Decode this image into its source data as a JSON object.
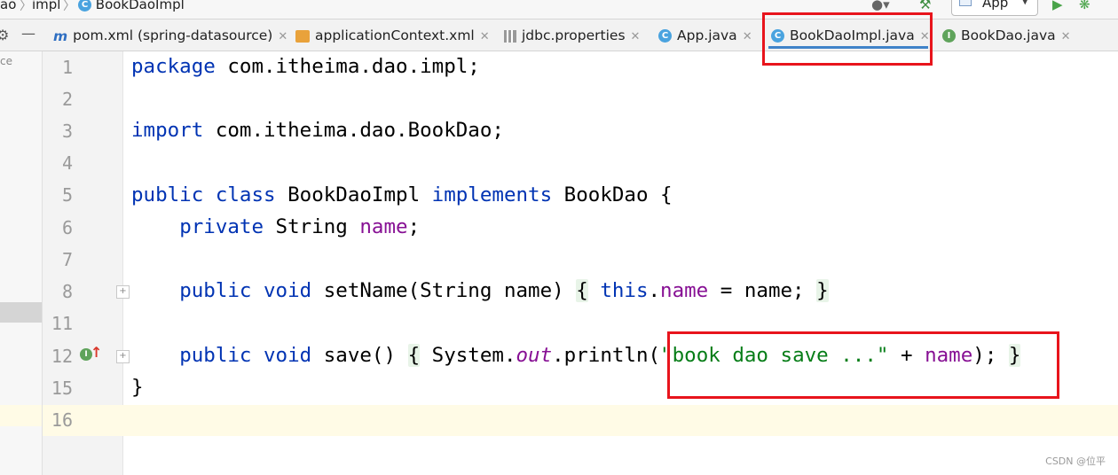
{
  "breadcrumb": {
    "seg1": "ao",
    "seg2": "impl",
    "seg3": "BookDaoImpl"
  },
  "toolbar": {
    "run_config": "App"
  },
  "tabs": [
    {
      "label": "pom.xml (spring-datasource)",
      "icon": "maven-icon"
    },
    {
      "label": "applicationContext.xml",
      "icon": "xml-icon"
    },
    {
      "label": "jdbc.properties",
      "icon": "properties-icon"
    },
    {
      "label": "App.java",
      "icon": "class-icon"
    },
    {
      "label": "BookDaoImpl.java",
      "icon": "class-icon",
      "active": true
    },
    {
      "label": "BookDao.java",
      "icon": "interface-icon"
    }
  ],
  "sidebar": {
    "partial_label": "ce"
  },
  "lines": [
    {
      "no": "1"
    },
    {
      "no": "2"
    },
    {
      "no": "3"
    },
    {
      "no": "4"
    },
    {
      "no": "5"
    },
    {
      "no": "6"
    },
    {
      "no": "7"
    },
    {
      "no": "8"
    },
    {
      "no": "11"
    },
    {
      "no": "12"
    },
    {
      "no": "15"
    },
    {
      "no": "16"
    }
  ],
  "code": {
    "l1_kw": "package",
    "l1_rest": " com.itheima.dao.impl;",
    "l3_kw": "import",
    "l3_rest": " com.itheima.dao.BookDao;",
    "l5_kw1": "public class",
    "l5_mid": " BookDaoImpl ",
    "l5_kw2": "implements",
    "l5_rest": " BookDao {",
    "l6_indent": "    ",
    "l6_kw": "private",
    "l6_mid": " String ",
    "l6_fld": "name",
    "l6_end": ";",
    "l8_indent": "    ",
    "l8_kw": "public void",
    "l8_mid": " setName(String name) ",
    "l8_ob": "{",
    "l8_sp": " ",
    "l8_this": "this",
    "l8_dot": ".",
    "l8_fld": "name",
    "l8_rest": " = name; ",
    "l8_cb": "}",
    "l12_indent": "    ",
    "l12_kw": "public void",
    "l12_mid": " save() ",
    "l12_ob": "{",
    "l12_sys": " System.",
    "l12_out": "out",
    "l12_println": ".println(",
    "l12_str": "\"book dao save ...\"",
    "l12_plus": " + ",
    "l12_fld": "name",
    "l12_end": "); ",
    "l12_cb": "}",
    "l15": "}"
  },
  "watermark": "CSDN @位平",
  "colors": {
    "keyword": "#0033b3",
    "field": "#871094",
    "string": "#067d17",
    "highlight": "#e8141c",
    "tab_underline": "#4083c9"
  }
}
